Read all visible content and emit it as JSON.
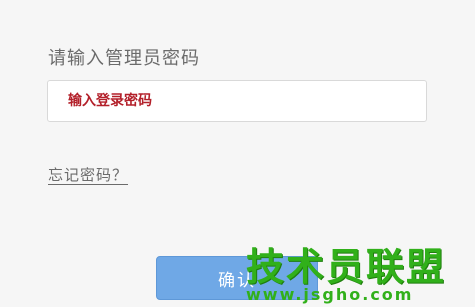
{
  "login": {
    "prompt": "请输入管理员密码",
    "password_placeholder": "输入登录密码",
    "password_value": "",
    "forgot_link": "忘记密码？",
    "confirm_button": "确认"
  },
  "watermark": {
    "name": "技术员联盟",
    "url": "www.jsgho.com"
  },
  "colors": {
    "background": "#f6f6f6",
    "placeholder_text": "#b3202a",
    "button_bg": "#6fa8e6",
    "watermark": "#31b01a"
  }
}
